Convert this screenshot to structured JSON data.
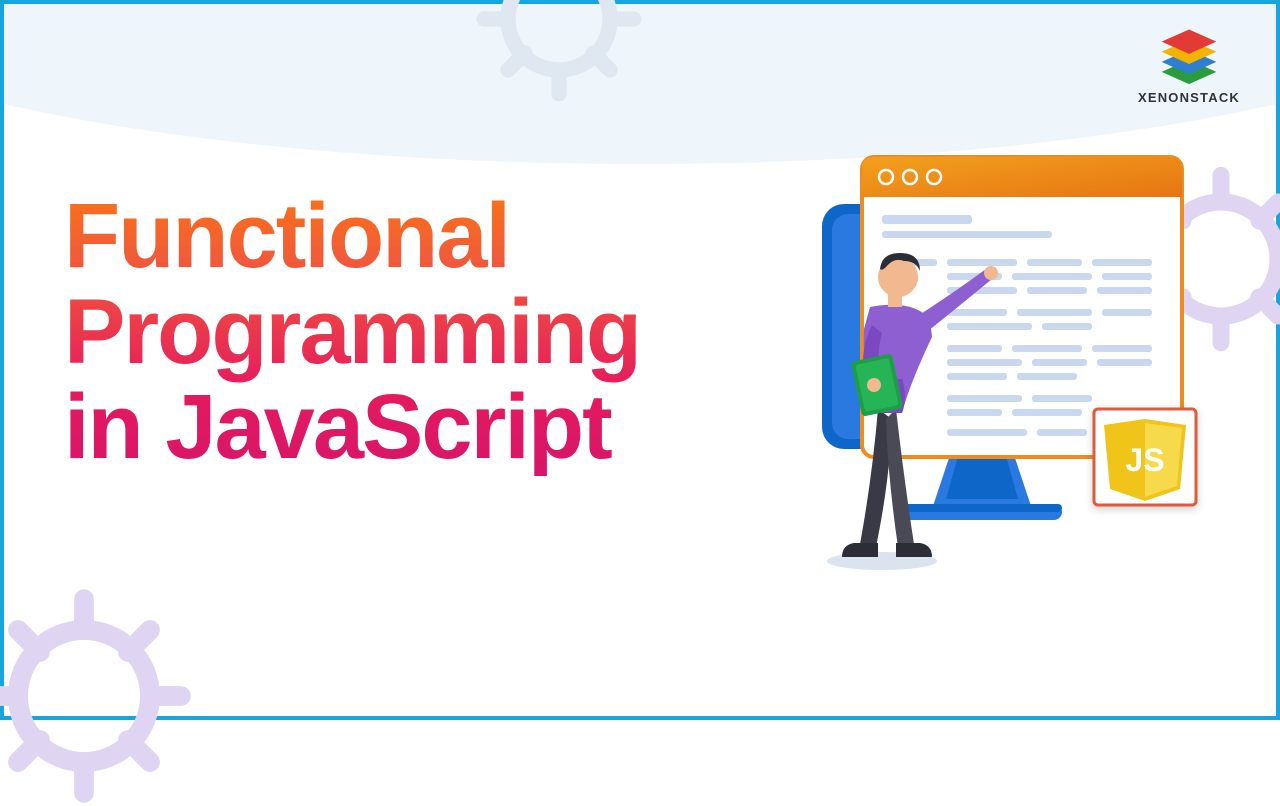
{
  "brand": {
    "name": "XENONSTACK"
  },
  "headline": {
    "line1": "Functional",
    "line2": "Programming",
    "line3": "in JavaScript"
  },
  "illustration": {
    "js_label": "JS"
  }
}
